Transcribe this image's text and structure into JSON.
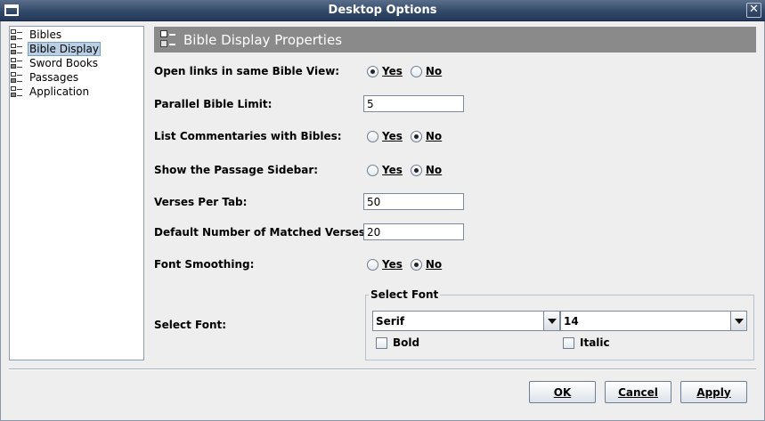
{
  "window": {
    "title": "Desktop Options"
  },
  "tree": {
    "items": [
      {
        "label": "Bibles",
        "selected": false
      },
      {
        "label": "Bible Display",
        "selected": true
      },
      {
        "label": "Sword Books",
        "selected": false
      },
      {
        "label": "Passages",
        "selected": false
      },
      {
        "label": "Application",
        "selected": false
      }
    ]
  },
  "panel": {
    "title": "Bible Display Properties",
    "open_links": {
      "label": "Open links in same Bible View:",
      "yes": "Yes",
      "no": "No",
      "selected": "yes"
    },
    "parallel_limit": {
      "label": "Parallel Bible Limit:",
      "value": "5"
    },
    "list_commentaries": {
      "label": "List Commentaries with Bibles:",
      "yes": "Yes",
      "no": "No",
      "selected": "no"
    },
    "passage_sidebar": {
      "label": "Show the Passage Sidebar:",
      "yes": "Yes",
      "no": "No",
      "selected": "no"
    },
    "verses_per_tab": {
      "label": "Verses Per Tab:",
      "value": "50"
    },
    "matched_verses": {
      "label": "Default Number of Matched Verses:",
      "value": "20"
    },
    "font_smoothing": {
      "label": "Font Smoothing:",
      "yes": "Yes",
      "no": "No",
      "selected": "no"
    },
    "select_font": {
      "label": "Select Font:",
      "group_title": "Select Font",
      "family": "Serif",
      "size": "14",
      "bold_label": "Bold",
      "italic_label": "Italic",
      "bold": false,
      "italic": false
    }
  },
  "buttons": {
    "ok": "OK",
    "cancel": "Cancel",
    "apply": "Apply"
  },
  "icons": {
    "window": "window-menu-icon",
    "close": "close-icon",
    "tree": "checklist-icon"
  }
}
